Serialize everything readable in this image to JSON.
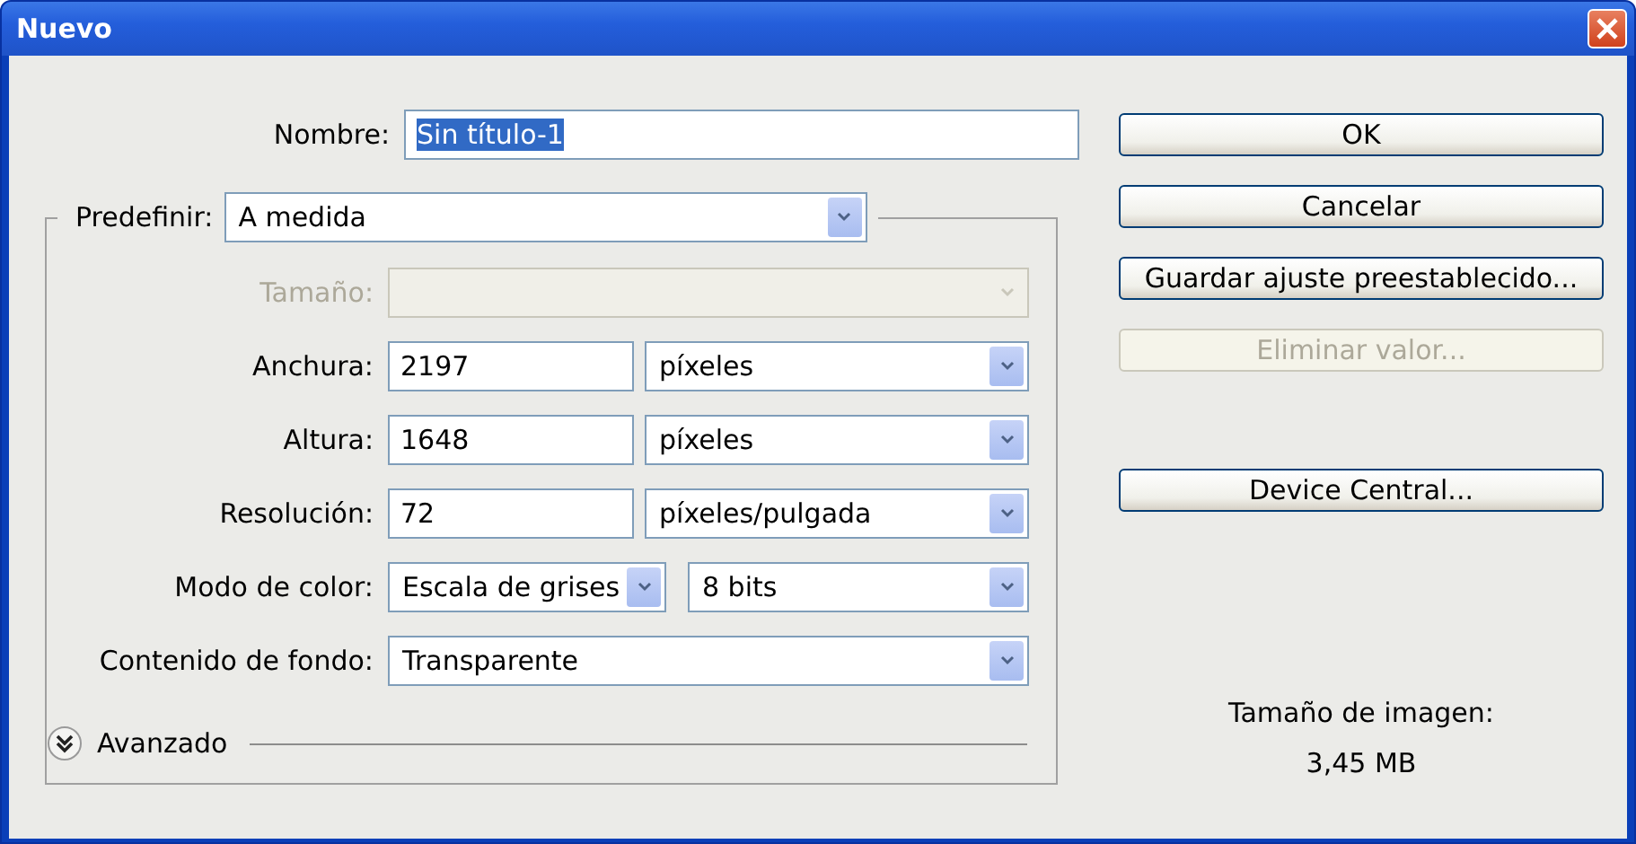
{
  "window": {
    "title": "Nuevo"
  },
  "name_field": {
    "label": "Nombre:",
    "value": "Sin título-1",
    "selected": true
  },
  "preset": {
    "label": "Predefinir:",
    "value": "A medida"
  },
  "fields": [
    {
      "kind": "select",
      "label": "Tamaño:",
      "disabled": true
    },
    {
      "kind": "number_unit",
      "label": "Anchura:",
      "value": "2197",
      "unit": "píxeles",
      "disabled": false
    },
    {
      "kind": "number_unit",
      "label": "Altura:",
      "value": "1648",
      "unit": "píxeles",
      "disabled": false
    },
    {
      "kind": "number_unit",
      "label": "Resolución:",
      "value": "72",
      "unit": "píxeles/pulgada",
      "disabled": false
    },
    {
      "kind": "dual_select",
      "label": "Modo de color:",
      "value": "Escala de grises",
      "unit": "8 bits",
      "disabled": false
    },
    {
      "kind": "select",
      "label": "Contenido de fondo:",
      "value": "Transparente",
      "disabled": false
    }
  ],
  "advanced": {
    "label": "Avanzado",
    "expanded": false
  },
  "buttons": [
    {
      "label": "OK",
      "disabled": false
    },
    {
      "label": "Cancelar",
      "disabled": false
    },
    {
      "label": "Guardar ajuste preestablecido...",
      "disabled": false
    },
    {
      "label": "Eliminar valor...",
      "disabled": true
    }
  ],
  "extra_buttons": [
    {
      "label": "Device Central...",
      "disabled": false
    }
  ],
  "image_size": {
    "label": "Tamaño de imagen:",
    "value": "3,45 MB"
  }
}
